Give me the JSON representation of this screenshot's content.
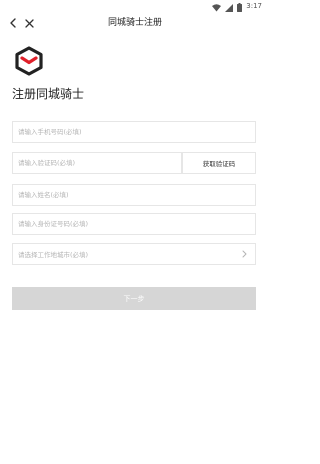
{
  "status_bar": {
    "time": "3:17",
    "icons": [
      "wifi-icon",
      "signal-icon",
      "battery-icon"
    ]
  },
  "nav": {
    "title": "同城骑士注册",
    "back_icon": "back-arrow-icon",
    "close_icon": "close-icon"
  },
  "brand": {
    "logo": "box-logo-icon",
    "heading": "注册同城骑士",
    "accent_color": "#e0202a",
    "dark_color": "#222222"
  },
  "form": {
    "phone_placeholder": "请输入手机号码(必填)",
    "code_placeholder": "请输入验证码(必填)",
    "get_code_label": "获取验证码",
    "name_placeholder": "请输入姓名(必填)",
    "id_placeholder": "请输入身份证号码(必填)",
    "city_placeholder": "请选择工作地城市(必填)",
    "next_label": "下一步",
    "next_button_color": "#d6d6d6"
  }
}
